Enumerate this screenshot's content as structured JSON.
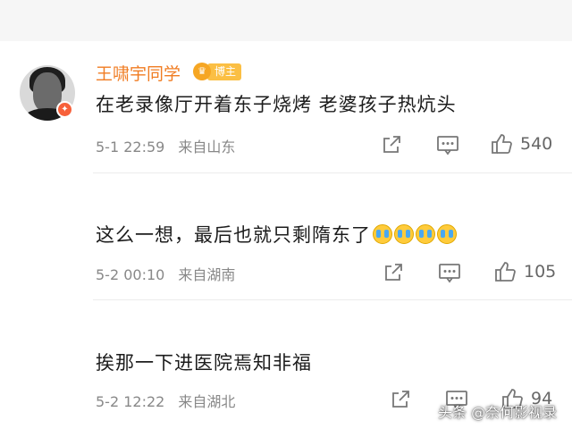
{
  "comments": [
    {
      "username": "王啸宇同学",
      "badge": "博主",
      "text": "在老录像厅开着东子烧烤 老婆孩子热炕头",
      "time": "5-1 22:59",
      "location": "来自山东",
      "likes": "540"
    },
    {
      "text": "这么一想，最后也就只剩隋东了",
      "emojis": [
        "crying-face",
        "crying-face",
        "crying-face",
        "crying-face"
      ],
      "time": "5-2 00:10",
      "location": "来自湖南",
      "likes": "105"
    },
    {
      "text": "挨那一下进医院焉知非福",
      "time": "5-2 12:22",
      "location": "来自湖北",
      "likes": "94"
    }
  ],
  "watermark": "头条 @奈何影视录",
  "colors": {
    "username": "#f07c22",
    "badge": "#fbbf44",
    "meta": "#888888"
  }
}
